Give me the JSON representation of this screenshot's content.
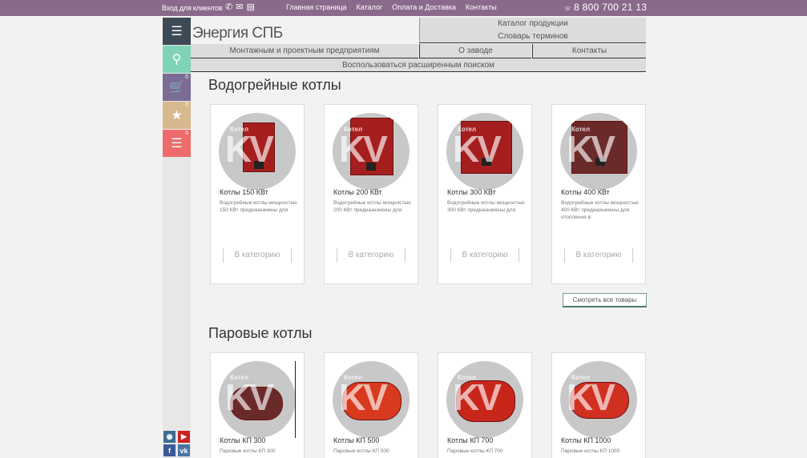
{
  "topbar": {
    "login": "Вход для клиентов",
    "icons": [
      "phone-icon",
      "mail-icon",
      "document-icon"
    ],
    "nav": [
      "Главная страница",
      "Каталог",
      "Оплата и Доставка",
      "Контакты"
    ],
    "phone_prefix": "☏",
    "phone": "8 800 700 21 13"
  },
  "header": {
    "logo": "Энергия СПБ",
    "catalog": "Каталог продукции",
    "glossary": "Словарь терминов",
    "montage": "Монтажным и проектным предприятиям",
    "about": "О заводе",
    "contacts": "Контакты",
    "advanced_search": "Воспользоваться расширенным поиском"
  },
  "sidebar": {
    "cart_count": "0",
    "fav_count": "0",
    "compare_count": "0",
    "icons": [
      "menu-icon",
      "search-icon",
      "cart-icon",
      "star-icon",
      "filter-icon"
    ]
  },
  "social": [
    "instagram-icon",
    "youtube-icon",
    "facebook-icon",
    "vk-icon"
  ],
  "watermark": {
    "brand": "KV",
    "label": "Котел"
  },
  "sections": {
    "water": {
      "title": "Водогрейные котлы",
      "cards": [
        {
          "name": "Котлы 150 КВт",
          "desc": "Водогрейные котлы мощностью 150 КВт предназначены для",
          "button": "В категорию"
        },
        {
          "name": "Котлы 200 КВт",
          "desc": "Водогрейные котлы мощностью 200 КВт предназначены для",
          "button": "В категорию"
        },
        {
          "name": "Котлы 300 КВт",
          "desc": "Водогрейные котлы мощностью 300 КВт предназначены для",
          "button": "В категорию"
        },
        {
          "name": "Котлы 400 КВт",
          "desc": "Водогрейные котлы мощностью 400 КВт предназначены для отопления в",
          "button": "В категорию"
        }
      ],
      "all_button": "Смотреть все товары"
    },
    "steam": {
      "title": "Паровые котлы",
      "cards": [
        {
          "name": "Котлы КП 300",
          "desc": "Паровые котлы КП 300"
        },
        {
          "name": "Котлы КП 500",
          "desc": "Паровые котлы КП 500"
        },
        {
          "name": "Котлы КП 700",
          "desc": "Паровые котлы КП 700"
        },
        {
          "name": "Котлы КП 1000",
          "desc": "Паровые котлы КП 1000"
        }
      ]
    }
  },
  "colors": {
    "topbar": "#8a6a8a",
    "menu": "#3d4a56",
    "search": "#7fd4b6",
    "cart": "#7a6c94",
    "fav": "#d8b98f",
    "compare": "#ee6b6b",
    "boiler": "#a51e1e"
  }
}
